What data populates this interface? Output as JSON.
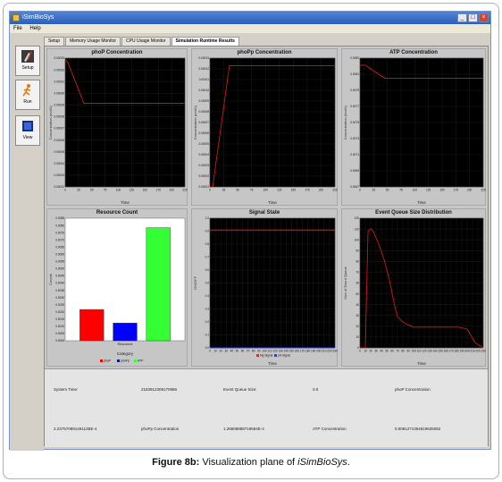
{
  "window": {
    "title": "iSimBioSys"
  },
  "menu": [
    "File",
    "Help"
  ],
  "toolbar": [
    {
      "label": "Setup",
      "icon": "setup-icon"
    },
    {
      "label": "Run",
      "icon": "run-icon"
    },
    {
      "label": "View",
      "icon": "view-icon"
    }
  ],
  "tabs": [
    "Setup",
    "Memory Usage Monitor",
    "CPU Usage Monitor",
    "Simulation Runtime Results"
  ],
  "active_tab": 3,
  "status": {
    "system_time_label": "System Time:",
    "system_time_value": "2183912309170986",
    "event_queue_label": "Event Queue Size:",
    "event_queue_value": "0.0",
    "phop_label": "phoP Concentration",
    "phop_value": "2.23757089149112BE-4",
    "phopp_label": "phoPp Concentration",
    "phopp_value": "1.26608888719684E-4",
    "atp_label": "ATP Concentration",
    "atp_value": "0.0081271354819635082"
  },
  "caption": {
    "prefix": "Figure 8b:",
    "text": " Visualization plane of ",
    "name": "iSimBioSys",
    "suffix": "."
  },
  "chart_data": [
    {
      "type": "line",
      "title": "phoP Concentration",
      "xlabel": "Time",
      "ylabel": "Concentration (mol/L)",
      "xlim": [
        0,
        225
      ],
      "xticks": [
        0,
        25,
        50,
        75,
        100,
        125,
        150,
        175,
        200,
        225
      ],
      "ylim": [
        0.000215,
        0.000332
      ],
      "yticks": [
        "0.00033",
        "0.00032",
        "0.00031",
        "0.00030",
        "0.00029",
        "0.00028",
        "0.00027",
        "0.00026",
        "0.00025",
        "0.00024",
        "0.00023",
        "0.00022"
      ],
      "series": [
        {
          "x": [
            0,
            5,
            35,
            225
          ],
          "y": [
            0.000331,
            0.000328,
            0.000291,
            0.000291
          ]
        }
      ]
    },
    {
      "type": "line",
      "title": "phoPp Concentration",
      "xlabel": "Time",
      "ylabel": "Concentration (mol/L)",
      "xlim": [
        0,
        225
      ],
      "xticks": [
        0,
        25,
        50,
        75,
        100,
        125,
        150,
        175,
        200,
        225
      ],
      "ylim": [
        0,
        0.000135
      ],
      "yticks": [
        "0.00013",
        "0.00012",
        "0.00011",
        "0.00010",
        "0.00009",
        "0.00008",
        "0.00007",
        "0.00006",
        "0.00005",
        "0.00004",
        "0.00003",
        "0.00002",
        "0.00001"
      ],
      "series": [
        {
          "x": [
            0,
            5,
            35,
            225
          ],
          "y": [
            0.0,
            0.0,
            0.000127,
            0.000127
          ]
        }
      ]
    },
    {
      "type": "line",
      "title": "ATP Concentration",
      "xlabel": "Time",
      "ylabel": "Concentration (mol/L)",
      "xlim": [
        0,
        225
      ],
      "xticks": [
        0,
        25,
        50,
        75,
        100,
        125,
        150,
        175,
        200,
        225
      ],
      "ylim": [
        0.0066,
        0.0084
      ],
      "yticks": [
        "0.0083",
        "0.0081",
        "0.0079",
        "0.0077",
        "0.0075",
        "0.0073",
        "0.0071",
        "0.0069",
        "0.0067"
      ],
      "series": [
        {
          "x": [
            0,
            10,
            45,
            225
          ],
          "y": [
            0.0083,
            0.0083,
            0.00812,
            0.00812
          ]
        }
      ]
    },
    {
      "type": "bar",
      "title": "Resource Count",
      "xlabel": "Category",
      "ylabel": "Counts",
      "xticklabel": "Resource",
      "categories": [
        "phoP",
        "phoPp",
        "ATP"
      ],
      "values": [
        0.00224,
        0.00127,
        0.00812
      ],
      "colors": [
        "#ff0000",
        "#0000ff",
        "#33ff33"
      ],
      "ylim": [
        0,
        0.0088
      ],
      "yticks": [
        "0.0085",
        "0.0080",
        "0.0075",
        "0.0070",
        "0.0065",
        "0.0060",
        "0.0055",
        "0.0050",
        "0.0045",
        "0.0040",
        "0.0035",
        "0.0030",
        "0.0025",
        "0.0020",
        "0.0015",
        "0.0010",
        "0.0005",
        "0.0000"
      ],
      "legend": [
        "phoP",
        "phoPp",
        "ATP"
      ]
    },
    {
      "type": "line",
      "title": "Signal State",
      "xlabel": "Time",
      "ylabel": "ON/OFF",
      "xlim": [
        0,
        230
      ],
      "xticks": [
        0,
        10,
        20,
        30,
        40,
        50,
        60,
        70,
        80,
        90,
        100,
        110,
        120,
        130,
        140,
        150,
        160,
        170,
        180,
        190,
        200,
        210,
        220,
        230
      ],
      "ylim": [
        0,
        1.1
      ],
      "yticks": [
        "1.0",
        "0.9",
        "0.8",
        "0.7",
        "0.6",
        "0.5",
        "0.4",
        "0.3",
        "0.2",
        "0.1",
        "0.0"
      ],
      "series": [
        {
          "name": "Mg Signal",
          "color": "#ff2020",
          "x": [
            0,
            230
          ],
          "y": [
            1.0,
            1.0
          ]
        },
        {
          "name": "pH Signal",
          "color": "#2040ff",
          "x": [
            0,
            230
          ],
          "y": [
            0.0,
            0.0
          ]
        }
      ]
    },
    {
      "type": "line",
      "title": "Event Queue Size Distribution",
      "xlabel": "Time",
      "ylabel": "Size of Event Queue",
      "xlim": [
        0,
        230
      ],
      "xticks": [
        0,
        10,
        20,
        30,
        40,
        50,
        60,
        70,
        80,
        90,
        100,
        110,
        120,
        130,
        140,
        150,
        160,
        170,
        180,
        190,
        200,
        210,
        220,
        230
      ],
      "ylim": [
        0,
        125
      ],
      "yticks": [
        "120",
        "110",
        "100",
        "90",
        "80",
        "70",
        "60",
        "50",
        "40",
        "30",
        "20",
        "10",
        "0"
      ],
      "series": [
        {
          "x": [
            0,
            10,
            15,
            20,
            25,
            35,
            45,
            55,
            65,
            70,
            80,
            90,
            100,
            120,
            140,
            170,
            185,
            200,
            215,
            230
          ],
          "y": [
            0,
            0,
            112,
            115,
            112,
            100,
            85,
            65,
            40,
            30,
            25,
            22,
            20,
            20,
            20,
            20,
            20,
            18,
            5,
            0
          ]
        }
      ]
    }
  ]
}
